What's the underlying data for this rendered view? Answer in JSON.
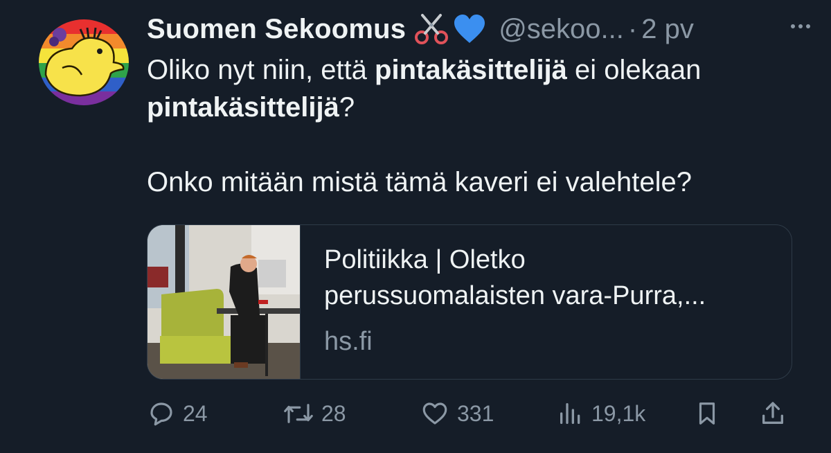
{
  "author": {
    "name": "Suomen Sekoomus",
    "handle": "@sekoo...",
    "time": "2 pv",
    "emojis": [
      "scissors-icon",
      "blue-heart-icon"
    ]
  },
  "tweet": {
    "line1_a": "Oliko nyt niin, että ",
    "line1_b": "pintakäsittelijä",
    "line1_c": " ei olekaan",
    "line2_a": "pintakäsittelijä",
    "line2_b": "?",
    "line3": "Onko mitään mistä tämä kaveri ei valehtele?"
  },
  "card": {
    "title_line1": "Politiikka | Oletko",
    "title_line2": "perussuomalaisten vara-Purra,...",
    "domain": "hs.fi"
  },
  "actions": {
    "replies": "24",
    "retweets": "28",
    "likes": "331",
    "views": "19,1k"
  },
  "colors": {
    "background": "#151d28",
    "text": "#eff3f4",
    "muted": "#8b98a5",
    "border": "#2f3b48"
  }
}
